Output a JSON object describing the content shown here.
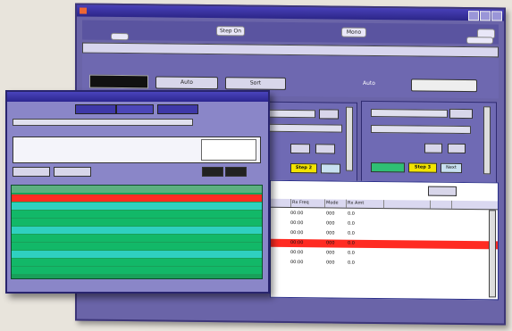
{
  "back_window": {
    "title": "",
    "mode_label": "Mono",
    "mode_button": "Step On",
    "dark_display": "",
    "controls_label": "Auto",
    "step_buttons": [
      "Step 2",
      "Step 3",
      "Next"
    ],
    "toolbar_buttons": [
      "Auto",
      "Sort"
    ],
    "grid_columns": [
      "Rx Freq",
      "Mode",
      "Rx Amt"
    ],
    "grid_rows": [
      {
        "freq": "00:00",
        "mode": "000",
        "amt": "0.0",
        "color": "#ffffff"
      },
      {
        "freq": "00:00",
        "mode": "000",
        "amt": "0.0",
        "color": "#ffffff"
      },
      {
        "freq": "00:00",
        "mode": "000",
        "amt": "0.0",
        "color": "#ffffff"
      },
      {
        "freq": "00:00",
        "mode": "000",
        "amt": "0.0",
        "color": "#ff2b22"
      },
      {
        "freq": "00:00",
        "mode": "000",
        "amt": "0.0",
        "color": "#ffffff"
      },
      {
        "freq": "00:00",
        "mode": "000",
        "amt": "0.0",
        "color": "#ffffff"
      }
    ]
  },
  "front_window": {
    "tabs": [
      "",
      "",
      ""
    ],
    "info_rows": [
      "",
      "",
      ""
    ],
    "grid_rows": [
      {
        "c1": "",
        "c2": "",
        "color": "#ff2b22"
      },
      {
        "c1": "",
        "c2": "",
        "color": "#2fd0c0"
      },
      {
        "c1": "",
        "c2": "",
        "color": "#12b868"
      },
      {
        "c1": "",
        "c2": "",
        "color": "#12b868"
      },
      {
        "c1": "",
        "c2": "",
        "color": "#2fd0c0"
      },
      {
        "c1": "",
        "c2": "",
        "color": "#12b868"
      },
      {
        "c1": "",
        "c2": "",
        "color": "#12b868"
      },
      {
        "c1": "",
        "c2": "",
        "color": "#2fd0c0"
      },
      {
        "c1": "",
        "c2": "",
        "color": "#12b868"
      },
      {
        "c1": "",
        "c2": "",
        "color": "#12b868"
      }
    ]
  },
  "colors": {
    "accent": "#3b3398",
    "highlight_row": "#ff2b22",
    "grid_green": "#12b868",
    "grid_teal": "#2fd0c0",
    "step_yellow": "#f3e400"
  }
}
